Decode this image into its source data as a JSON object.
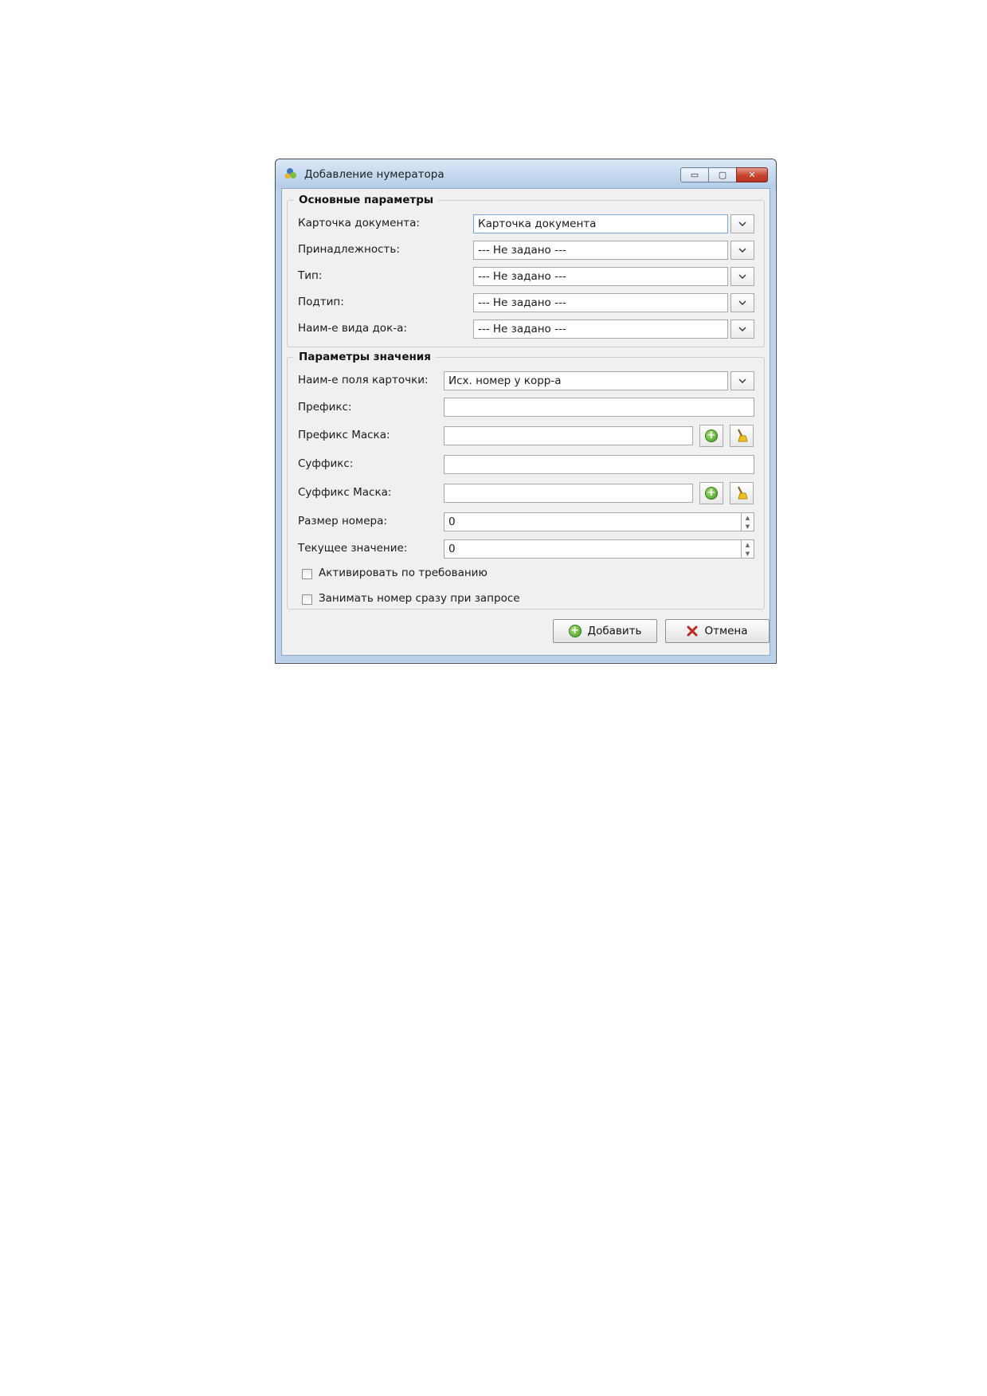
{
  "window": {
    "title": "Добавление нумератора",
    "controls": {
      "minimize": "▭",
      "maximize": "▢",
      "close": "✕"
    }
  },
  "main_params": {
    "legend": "Основные параметры",
    "rows": [
      {
        "label": "Карточка документа:",
        "value": "Карточка документа"
      },
      {
        "label": "Принадлежность:",
        "value": "--- Не задано ---"
      },
      {
        "label": "Тип:",
        "value": "--- Не задано ---"
      },
      {
        "label": "Подтип:",
        "value": "--- Не задано ---"
      },
      {
        "label": "Наим-е вида док-а:",
        "value": "--- Не задано ---"
      }
    ]
  },
  "value_params": {
    "legend": "Параметры значения",
    "field_name": {
      "label": "Наим-е поля карточки:",
      "value": "Исх. номер у корр-а"
    },
    "prefix": {
      "label": "Префикс:",
      "value": ""
    },
    "prefix_mask": {
      "label": "Префикс Маска:",
      "value": ""
    },
    "suffix": {
      "label": "Суффикс:",
      "value": ""
    },
    "suffix_mask": {
      "label": "Суффикс Маска:",
      "value": ""
    },
    "number_size": {
      "label": "Размер номера:",
      "value": "0"
    },
    "current_value": {
      "label": "Текущее значение:",
      "value": "0"
    },
    "checkboxes": [
      {
        "label": "Активировать по требованию",
        "checked": false
      },
      {
        "label": "Занимать номер сразу при запросе",
        "checked": false
      }
    ]
  },
  "buttons": {
    "add": "Добавить",
    "cancel": "Отмена"
  },
  "icons": {
    "dropdown": "chevron-down-icon",
    "add_mask": "add-circle-icon",
    "clear_mask": "broom-icon",
    "add_button": "add-circle-icon",
    "cancel_button": "red-x-icon"
  },
  "colors": {
    "accent_green": "#3d9a1e",
    "cancel_red": "#c0281c",
    "title_bar": "#c2d7ee"
  }
}
